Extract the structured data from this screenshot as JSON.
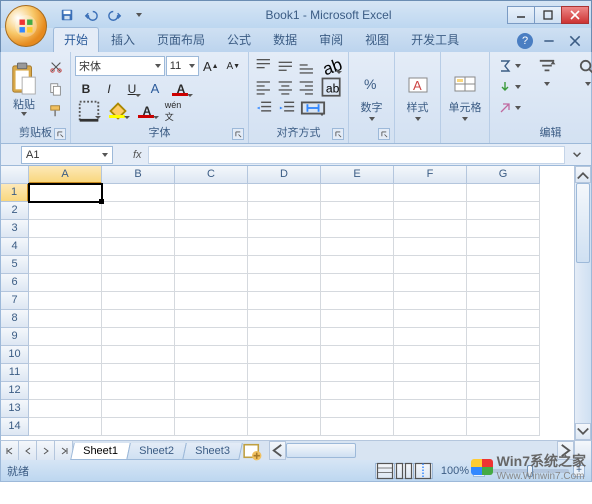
{
  "title": "Book1 - Microsoft Excel",
  "tabs": [
    "开始",
    "插入",
    "页面布局",
    "公式",
    "数据",
    "审阅",
    "视图",
    "开发工具"
  ],
  "active_tab_index": 0,
  "groups": {
    "clipboard": {
      "label": "剪贴板",
      "paste": "粘贴"
    },
    "font": {
      "label": "字体",
      "name": "宋体",
      "size": "11"
    },
    "alignment": {
      "label": "对齐方式"
    },
    "number": {
      "label": "数字"
    },
    "styles": {
      "label": "样式"
    },
    "cells": {
      "label": "单元格"
    },
    "editing": {
      "label": "编辑"
    }
  },
  "name_box": "A1",
  "columns": [
    "A",
    "B",
    "C",
    "D",
    "E",
    "F",
    "G"
  ],
  "rows": [
    1,
    2,
    3,
    4,
    5,
    6,
    7,
    8,
    9,
    10,
    11,
    12,
    13,
    14
  ],
  "active_cell": {
    "row": 1,
    "col": "A"
  },
  "sheets": [
    "Sheet1",
    "Sheet2",
    "Sheet3"
  ],
  "active_sheet_index": 0,
  "status": "就绪",
  "zoom": "100%",
  "watermark": {
    "brand": "Win7系统之家",
    "url": "Www.Winwin7.Com"
  }
}
